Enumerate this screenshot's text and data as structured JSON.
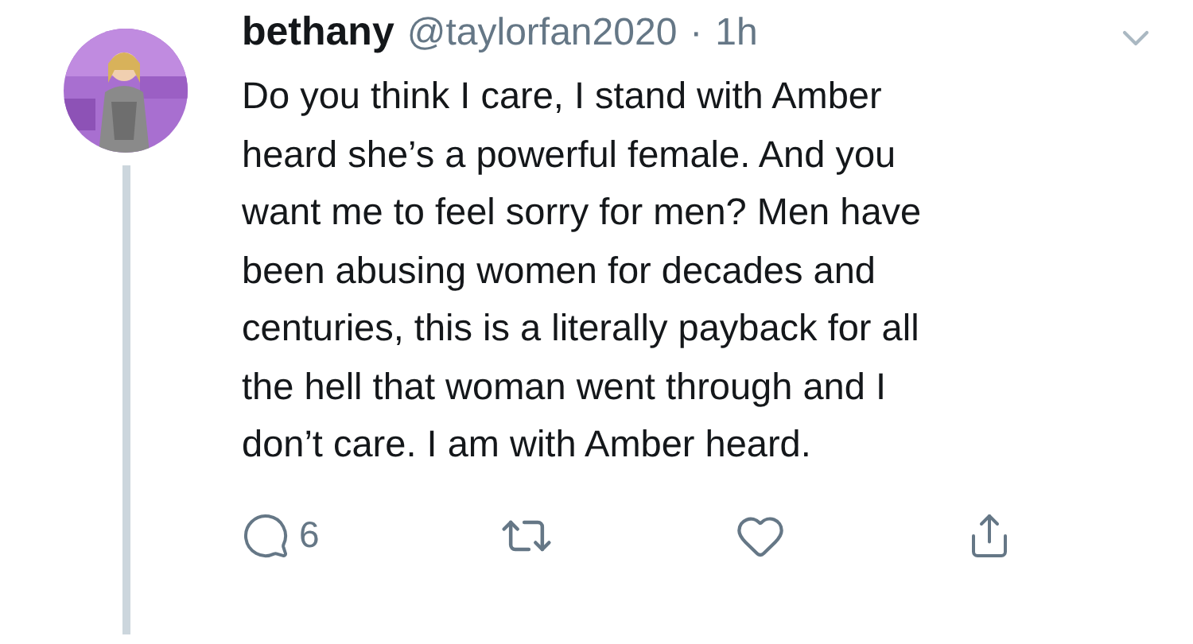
{
  "tweet": {
    "name": "bethany",
    "handle": "@taylorfan2020",
    "separator": "·",
    "time": "1h",
    "body_lines": [
      "Do you think I care, I stand with Amber",
      "heard she’s a powerful female. And you",
      "want me to feel sorry for men? Men have",
      "been abusing women for decades and",
      "centuries, this is a literally payback for all",
      "the hell that woman went through and I",
      "don’t care. I am with Amber heard."
    ],
    "reply_count": "6"
  }
}
